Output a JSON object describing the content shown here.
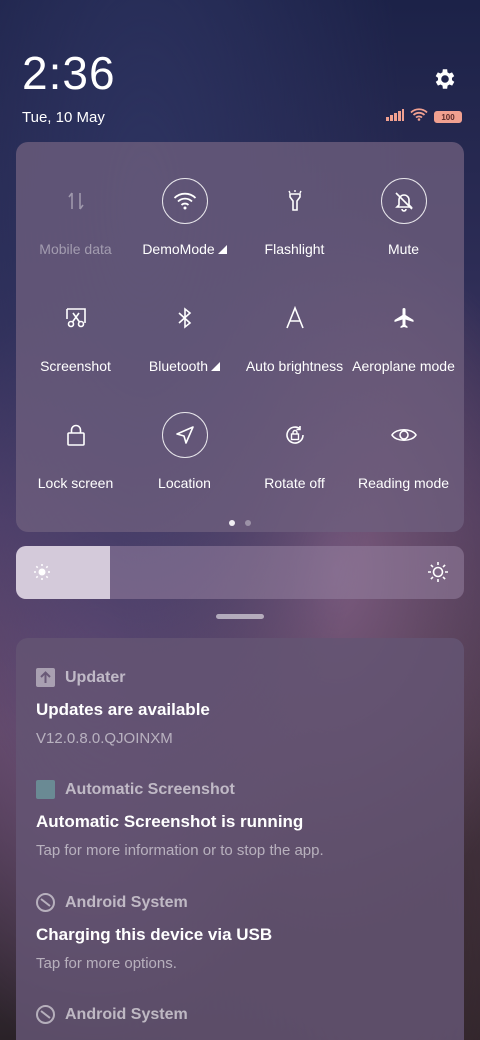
{
  "status_bar": {
    "time": "2:36",
    "date": "Tue, 10 May",
    "battery": "100",
    "icons": [
      "signal-icon",
      "wifi-icon",
      "battery-icon"
    ],
    "settings_icon": "gear-icon"
  },
  "quick_settings": {
    "tiles": [
      {
        "label": "Mobile data",
        "icon": "mobile-data-icon",
        "state": "disabled"
      },
      {
        "label": "DemoMode",
        "icon": "wifi-icon",
        "state": "on",
        "expandable": true
      },
      {
        "label": "Flashlight",
        "icon": "flashlight-icon",
        "state": "off"
      },
      {
        "label": "Mute",
        "icon": "bell-off-icon",
        "state": "on"
      },
      {
        "label": "Screenshot",
        "icon": "screenshot-icon",
        "state": "off"
      },
      {
        "label": "Bluetooth",
        "icon": "bluetooth-icon",
        "state": "off",
        "expandable": true
      },
      {
        "label": "Auto brightness",
        "icon": "auto-brightness-icon",
        "state": "off"
      },
      {
        "label": "Aeroplane mode",
        "icon": "airplane-icon",
        "state": "off"
      },
      {
        "label": "Lock screen",
        "icon": "lock-icon",
        "state": "off"
      },
      {
        "label": "Location",
        "icon": "location-icon",
        "state": "on"
      },
      {
        "label": "Rotate off",
        "icon": "rotate-lock-icon",
        "state": "off"
      },
      {
        "label": "Reading mode",
        "icon": "eye-icon",
        "state": "off"
      }
    ],
    "page_current": 1,
    "page_count": 2
  },
  "brightness": {
    "level_percent": 21
  },
  "notifications": [
    {
      "app": "Updater",
      "app_icon": "updater-icon",
      "title": "Updates are available",
      "body": "V12.0.8.0.QJOINXM"
    },
    {
      "app": "Automatic Screenshot",
      "app_icon": "app-square-icon",
      "title": "Automatic Screenshot is running",
      "body": "Tap for more information or to stop the app."
    },
    {
      "app": "Android System",
      "app_icon": "android-system-icon",
      "title": "Charging this device via USB",
      "body": "Tap for more options."
    },
    {
      "app": "Android System",
      "app_icon": "android-system-icon",
      "title": "",
      "body": ""
    }
  ],
  "colors": {
    "panel": "#6e5f7d",
    "battery": "#f1a090",
    "signal": "#f1a090"
  }
}
